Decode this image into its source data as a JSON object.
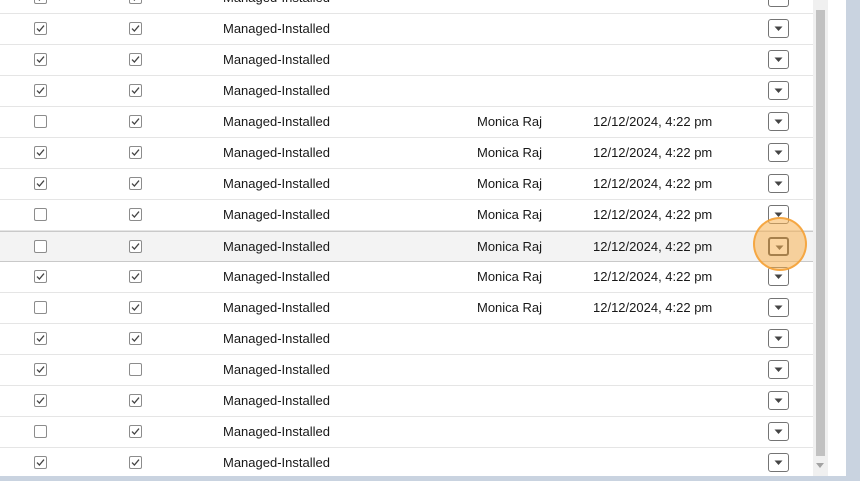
{
  "table": {
    "rows": [
      {
        "c1": true,
        "c2": true,
        "type": "Managed-Installed",
        "user": "",
        "date": ""
      },
      {
        "c1": true,
        "c2": true,
        "type": "Managed-Installed",
        "user": "",
        "date": ""
      },
      {
        "c1": true,
        "c2": true,
        "type": "Managed-Installed",
        "user": "",
        "date": ""
      },
      {
        "c1": true,
        "c2": true,
        "type": "Managed-Installed",
        "user": "",
        "date": ""
      },
      {
        "c1": false,
        "c2": true,
        "type": "Managed-Installed",
        "user": "Monica Raj",
        "date": "12/12/2024, 4:22 pm"
      },
      {
        "c1": true,
        "c2": true,
        "type": "Managed-Installed",
        "user": "Monica Raj",
        "date": "12/12/2024, 4:22 pm"
      },
      {
        "c1": true,
        "c2": true,
        "type": "Managed-Installed",
        "user": "Monica Raj",
        "date": "12/12/2024, 4:22 pm"
      },
      {
        "c1": false,
        "c2": true,
        "type": "Managed-Installed",
        "user": "Monica Raj",
        "date": "12/12/2024, 4:22 pm"
      },
      {
        "c1": false,
        "c2": true,
        "type": "Managed-Installed",
        "user": "Monica Raj",
        "date": "12/12/2024, 4:22 pm"
      },
      {
        "c1": true,
        "c2": true,
        "type": "Managed-Installed",
        "user": "Monica Raj",
        "date": "12/12/2024, 4:22 pm"
      },
      {
        "c1": false,
        "c2": true,
        "type": "Managed-Installed",
        "user": "Monica Raj",
        "date": "12/12/2024, 4:22 pm"
      },
      {
        "c1": true,
        "c2": true,
        "type": "Managed-Installed",
        "user": "",
        "date": ""
      },
      {
        "c1": true,
        "c2": false,
        "type": "Managed-Installed",
        "user": "",
        "date": ""
      },
      {
        "c1": true,
        "c2": true,
        "type": "Managed-Installed",
        "user": "",
        "date": ""
      },
      {
        "c1": false,
        "c2": true,
        "type": "Managed-Installed",
        "user": "",
        "date": ""
      },
      {
        "c1": true,
        "c2": true,
        "type": "Managed-Installed",
        "user": "",
        "date": ""
      }
    ],
    "hovered_row": 8,
    "focused_menu_row": 8
  },
  "icons": {
    "checkbox_checked": "checkmark-icon",
    "row_menu": "chevron-down-icon"
  },
  "colors": {
    "focus_highlight": "#f8b254",
    "checkbox_border": "#8c8c8c",
    "row_divider": "#e5e5e5"
  }
}
